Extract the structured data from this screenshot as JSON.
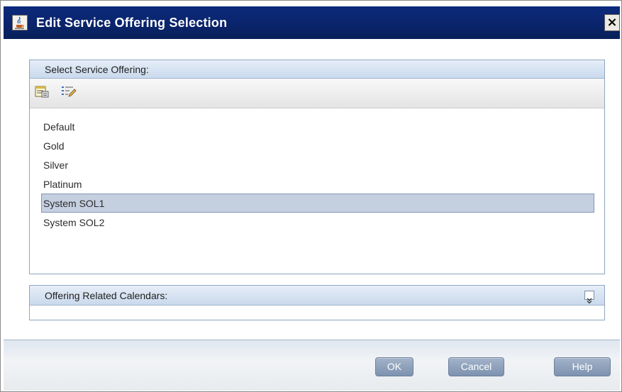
{
  "dialog": {
    "title": "Edit Service Offering Selection",
    "close_label": "×",
    "title_icon": "java-cup-icon"
  },
  "select_panel": {
    "header": "Select Service Offering:",
    "toolbar": {
      "properties_icon": "properties-icon",
      "edit_icon": "edit-list-icon"
    },
    "items": [
      {
        "label": "Default",
        "selected": false
      },
      {
        "label": "Gold",
        "selected": false
      },
      {
        "label": "Silver",
        "selected": false
      },
      {
        "label": "Platinum",
        "selected": false
      },
      {
        "label": "System SOL1",
        "selected": true
      },
      {
        "label": "System SOL2",
        "selected": false
      }
    ]
  },
  "calendars_panel": {
    "header": "Offering Related Calendars:",
    "expand_icon": "double-chevron-down-icon"
  },
  "buttons": {
    "ok": "OK",
    "cancel": "Cancel",
    "help": "Help"
  },
  "colors": {
    "titlebar": "#0a246a",
    "selection": "#c4cfe0",
    "button": "#8a9dba"
  }
}
